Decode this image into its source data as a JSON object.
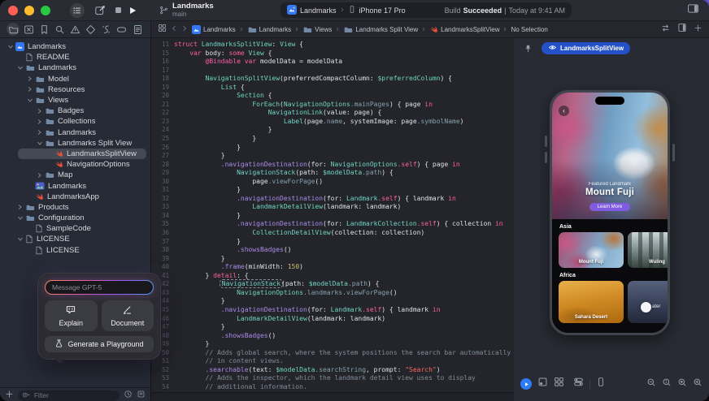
{
  "window": {
    "project_title": "Landmarks",
    "branch": "main"
  },
  "toolbar": {
    "scheme": "Landmarks",
    "device": "iPhone 17 Pro",
    "status": {
      "prefix": "Build",
      "result": "Succeeded",
      "sep": "|",
      "time": "Today at 9:41 AM"
    }
  },
  "navigator": {
    "tabs": [
      {
        "name": "project",
        "icon": "folder",
        "selected": true
      },
      {
        "name": "changes",
        "icon": "xsquare"
      },
      {
        "name": "bookmarks",
        "icon": "bookmark"
      },
      {
        "name": "find",
        "icon": "search"
      },
      {
        "name": "issues",
        "icon": "warning"
      },
      {
        "name": "tests",
        "icon": "diamond"
      },
      {
        "name": "debug",
        "icon": "debug"
      },
      {
        "name": "breakpoints",
        "icon": "capsule"
      },
      {
        "name": "reports",
        "icon": "report"
      }
    ],
    "items": [
      {
        "depth": 0,
        "chevron": "down",
        "icon": "project",
        "label": "Landmarks"
      },
      {
        "depth": 1,
        "chevron": "none",
        "icon": "doc",
        "label": "README"
      },
      {
        "depth": 1,
        "chevron": "down",
        "icon": "folder",
        "label": "Landmarks"
      },
      {
        "depth": 2,
        "chevron": "right",
        "icon": "folder",
        "label": "Model"
      },
      {
        "depth": 2,
        "chevron": "right",
        "icon": "folder",
        "label": "Resources"
      },
      {
        "depth": 2,
        "chevron": "down",
        "icon": "folder",
        "label": "Views"
      },
      {
        "depth": 3,
        "chevron": "right",
        "icon": "folder",
        "label": "Badges"
      },
      {
        "depth": 3,
        "chevron": "right",
        "icon": "folder",
        "label": "Collections"
      },
      {
        "depth": 3,
        "chevron": "right",
        "icon": "folder",
        "label": "Landmarks"
      },
      {
        "depth": 3,
        "chevron": "down",
        "icon": "folder",
        "label": "Landmarks Split View"
      },
      {
        "depth": 4,
        "chevron": "none",
        "icon": "swift",
        "label": "LandmarksSplitView",
        "selected": true
      },
      {
        "depth": 4,
        "chevron": "none",
        "icon": "swift",
        "label": "NavigationOptions"
      },
      {
        "depth": 3,
        "chevron": "right",
        "icon": "folder",
        "label": "Map"
      },
      {
        "depth": 2,
        "chevron": "none",
        "icon": "photo",
        "label": "Landmarks"
      },
      {
        "depth": 2,
        "chevron": "none",
        "icon": "swift",
        "label": "LandmarksApp"
      },
      {
        "depth": 1,
        "chevron": "right",
        "icon": "folder",
        "label": "Products"
      },
      {
        "depth": 1,
        "chevron": "down",
        "icon": "folder",
        "label": "Configuration"
      },
      {
        "depth": 2,
        "chevron": "none",
        "icon": "doc",
        "label": "SampleCode"
      },
      {
        "depth": 1,
        "chevron": "down",
        "icon": "doc",
        "label": "LICENSE"
      },
      {
        "depth": 2,
        "chevron": "none",
        "icon": "doc",
        "label": "LICENSE"
      }
    ],
    "filter_placeholder": "Filter"
  },
  "jumpbar": {
    "crumbs": [
      {
        "icon": "project",
        "label": "Landmarks"
      },
      {
        "icon": "folder",
        "label": "Landmarks"
      },
      {
        "icon": "folder",
        "label": "Views"
      },
      {
        "icon": "folder",
        "label": "Landmarks Split View"
      },
      {
        "icon": "swift",
        "label": "LandmarksSplitView"
      },
      {
        "icon": "",
        "label": "No Selection"
      }
    ]
  },
  "editor": {
    "lines": [
      {
        "n": 11,
        "t": [
          [
            "k",
            "struct "
          ],
          [
            "t",
            "LandmarksSplitView"
          ],
          [
            "p",
            ": "
          ],
          [
            "t",
            "View"
          ],
          [
            "p",
            " {"
          ]
        ]
      },
      {
        "n": 15,
        "t": [
          [
            "p",
            "    "
          ],
          [
            "k",
            "var "
          ],
          [
            "p",
            "body: "
          ],
          [
            "k",
            "some "
          ],
          [
            "t",
            "View"
          ],
          [
            "p",
            " {"
          ]
        ]
      },
      {
        "n": 16,
        "t": [
          [
            "p",
            "        "
          ],
          [
            "k",
            "@Bindable "
          ],
          [
            "k",
            "var "
          ],
          [
            "p",
            "modelData = modelData"
          ]
        ]
      },
      {
        "n": 17,
        "t": []
      },
      {
        "n": 18,
        "t": [
          [
            "p",
            "        "
          ],
          [
            "t",
            "NavigationSplitView"
          ],
          [
            "p",
            "(preferredCompactColumn: "
          ],
          [
            "t",
            "$preferredColumn"
          ],
          [
            "p",
            ") {"
          ]
        ]
      },
      {
        "n": 19,
        "t": [
          [
            "p",
            "            "
          ],
          [
            "t",
            "List"
          ],
          [
            "p",
            " {"
          ]
        ]
      },
      {
        "n": 20,
        "t": [
          [
            "p",
            "                "
          ],
          [
            "t",
            "Section"
          ],
          [
            "p",
            " {"
          ]
        ]
      },
      {
        "n": 21,
        "t": [
          [
            "p",
            "                    "
          ],
          [
            "t",
            "ForEach"
          ],
          [
            "p",
            "("
          ],
          [
            "t",
            "NavigationOptions"
          ],
          [
            "pr",
            ".mainPages"
          ],
          [
            "p",
            ") { page "
          ],
          [
            "k",
            "in"
          ]
        ]
      },
      {
        "n": 22,
        "t": [
          [
            "p",
            "                        "
          ],
          [
            "t",
            "NavigationLink"
          ],
          [
            "p",
            "(value: page) {"
          ]
        ]
      },
      {
        "n": 23,
        "t": [
          [
            "p",
            "                            "
          ],
          [
            "t",
            "Label"
          ],
          [
            "p",
            "(page"
          ],
          [
            "pr",
            ".name"
          ],
          [
            "p",
            ", systemImage: page"
          ],
          [
            "pr",
            ".symbolName"
          ],
          [
            "p",
            ")"
          ]
        ]
      },
      {
        "n": 24,
        "t": [
          [
            "p",
            "                        }"
          ]
        ]
      },
      {
        "n": 25,
        "t": [
          [
            "p",
            "                    }"
          ]
        ]
      },
      {
        "n": 26,
        "t": [
          [
            "p",
            "                }"
          ]
        ]
      },
      {
        "n": 27,
        "t": [
          [
            "p",
            "            }"
          ]
        ]
      },
      {
        "n": 28,
        "t": [
          [
            "p",
            "            "
          ],
          [
            "m",
            ".navigationDestination"
          ],
          [
            "p",
            "(for: "
          ],
          [
            "t",
            "NavigationOptions"
          ],
          [
            "k",
            ".self"
          ],
          [
            "p",
            ") { page "
          ],
          [
            "k",
            "in"
          ]
        ]
      },
      {
        "n": 29,
        "t": [
          [
            "p",
            "                "
          ],
          [
            "t",
            "NavigationStack"
          ],
          [
            "p",
            "(path: "
          ],
          [
            "t",
            "$modelData"
          ],
          [
            "pr",
            ".path"
          ],
          [
            "p",
            ") {"
          ]
        ]
      },
      {
        "n": 30,
        "t": [
          [
            "p",
            "                    page"
          ],
          [
            "pr",
            ".viewForPage"
          ],
          [
            "p",
            "()"
          ]
        ]
      },
      {
        "n": 31,
        "t": [
          [
            "p",
            "                }"
          ]
        ]
      },
      {
        "n": 32,
        "t": [
          [
            "p",
            "                "
          ],
          [
            "m",
            ".navigationDestination"
          ],
          [
            "p",
            "(for: "
          ],
          [
            "t",
            "Landmark"
          ],
          [
            "k",
            ".self"
          ],
          [
            "p",
            ") { landmark "
          ],
          [
            "k",
            "in"
          ]
        ]
      },
      {
        "n": 33,
        "t": [
          [
            "p",
            "                    "
          ],
          [
            "t",
            "LandmarkDetailView"
          ],
          [
            "p",
            "(landmark: landmark)"
          ]
        ]
      },
      {
        "n": 34,
        "t": [
          [
            "p",
            "                }"
          ]
        ]
      },
      {
        "n": 35,
        "t": [
          [
            "p",
            "                "
          ],
          [
            "m",
            ".navigationDestination"
          ],
          [
            "p",
            "(for: "
          ],
          [
            "t",
            "LandmarkCollection"
          ],
          [
            "k",
            ".self"
          ],
          [
            "p",
            ") { collection "
          ],
          [
            "k",
            "in"
          ]
        ]
      },
      {
        "n": 36,
        "t": [
          [
            "p",
            "                    "
          ],
          [
            "t",
            "CollectionDetailView"
          ],
          [
            "p",
            "(collection: collection)"
          ]
        ]
      },
      {
        "n": 37,
        "t": [
          [
            "p",
            "                }"
          ]
        ]
      },
      {
        "n": 38,
        "t": [
          [
            "p",
            "                "
          ],
          [
            "m",
            ".showsBadges"
          ],
          [
            "p",
            "()"
          ]
        ]
      },
      {
        "n": 39,
        "t": [
          [
            "p",
            "            }"
          ]
        ]
      },
      {
        "n": 40,
        "t": [
          [
            "p",
            "            "
          ],
          [
            "m",
            ".frame"
          ],
          [
            "p",
            "(minWidth: "
          ],
          [
            "n",
            "150"
          ],
          [
            "p",
            ")"
          ]
        ]
      },
      {
        "n": 41,
        "t": [
          [
            "p",
            "        } "
          ],
          [
            "k",
            "detail"
          ],
          [
            "p",
            ": {"
          ]
        ]
      },
      {
        "n": 42,
        "t": [
          [
            "p",
            "            "
          ],
          [
            "sel",
            "NavigationStack"
          ],
          [
            "p",
            "(path: "
          ],
          [
            "t",
            "$modelData"
          ],
          [
            "pr",
            ".path"
          ],
          [
            "p",
            ") {"
          ]
        ]
      },
      {
        "n": 43,
        "t": [
          [
            "p",
            "                "
          ],
          [
            "t",
            "NavigationOptions"
          ],
          [
            "pr",
            ".landmarks"
          ],
          [
            "pr",
            ".viewForPage"
          ],
          [
            "p",
            "()"
          ]
        ]
      },
      {
        "n": 44,
        "t": [
          [
            "p",
            "            }"
          ]
        ]
      },
      {
        "n": 45,
        "t": [
          [
            "p",
            "            "
          ],
          [
            "m",
            ".navigationDestination"
          ],
          [
            "p",
            "(for: "
          ],
          [
            "t",
            "Landmark"
          ],
          [
            "k",
            ".self"
          ],
          [
            "p",
            ") { landmark "
          ],
          [
            "k",
            "in"
          ]
        ]
      },
      {
        "n": 46,
        "t": [
          [
            "p",
            "                "
          ],
          [
            "t",
            "LandmarkDetailView"
          ],
          [
            "p",
            "(landmark: landmark)"
          ]
        ]
      },
      {
        "n": 47,
        "t": [
          [
            "p",
            "            }"
          ]
        ]
      },
      {
        "n": 48,
        "t": [
          [
            "p",
            "            "
          ],
          [
            "m",
            ".showsBadges"
          ],
          [
            "p",
            "()"
          ]
        ]
      },
      {
        "n": 49,
        "t": [
          [
            "p",
            "        }"
          ]
        ]
      },
      {
        "n": 50,
        "t": [
          [
            "p",
            "        "
          ],
          [
            "c",
            "// Adds global search, where the system positions the search bar automatically"
          ]
        ]
      },
      {
        "n": 51,
        "t": [
          [
            "p",
            "        "
          ],
          [
            "c",
            "// in content views."
          ]
        ]
      },
      {
        "n": 52,
        "t": [
          [
            "p",
            "        "
          ],
          [
            "m",
            ".searchable"
          ],
          [
            "p",
            "(text: "
          ],
          [
            "t",
            "$modelData"
          ],
          [
            "pr",
            ".searchString"
          ],
          [
            "p",
            ", prompt: "
          ],
          [
            "s",
            "\"Search\""
          ],
          [
            "p",
            ")"
          ]
        ]
      },
      {
        "n": 53,
        "t": [
          [
            "p",
            "        "
          ],
          [
            "c",
            "// Adds the inspector, which the landmark detail view uses to display"
          ]
        ]
      },
      {
        "n": 54,
        "t": [
          [
            "p",
            "        "
          ],
          [
            "c",
            "// additional information."
          ]
        ]
      }
    ]
  },
  "assistant": {
    "input_placeholder": "Message GPT-5",
    "explain_label": "Explain",
    "document_label": "Document",
    "generate_label": "Generate a Playground"
  },
  "canvas": {
    "preview_chip": "LandmarksSplitView",
    "phone": {
      "featured_label": "Featured Landmark",
      "featured_title": "Mount Fuji",
      "cta": "Learn More",
      "sections": [
        {
          "title": "Asia",
          "cards": [
            {
              "label": "Mount Fuji",
              "style": "blossom"
            },
            {
              "label": "Wuling",
              "style": "cliffs"
            }
          ]
        },
        {
          "title": "Africa",
          "cards": [
            {
              "label": "Sahara Desert",
              "style": "desert"
            },
            {
              "label": "ater",
              "style": "night",
              "touch": true
            }
          ]
        }
      ]
    }
  },
  "colors": {
    "accent_blue": "#2450c8",
    "run_blue": "#2e7bf6",
    "cta_purple": "#7e5be0",
    "traffic": [
      "#ff5f57",
      "#febc2e",
      "#28c840"
    ]
  }
}
